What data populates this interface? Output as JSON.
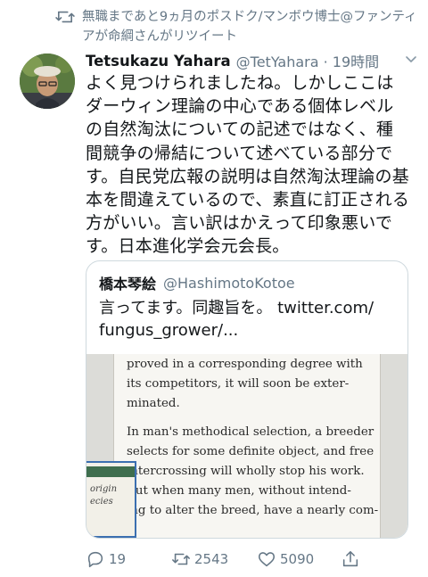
{
  "retweet": {
    "text": "無職まであと9ヵ月のポスドク/マンボウ博士@ファンティアが命綱さんがリツイート",
    "icon": "retweet-icon"
  },
  "tweet": {
    "display_name": "Tetsukazu Yahara",
    "handle_time": "@TetYahara · 19時間",
    "lines": [
      "よく見つけられましたね。しかしここは",
      "ダーウィン理論の中心である個体レベル",
      "の自然淘汰についての記述ではなく、種",
      "間競争の帰結について述べている部分で",
      "す。自民党広報の説明は自然淘汰理論の基",
      "本を間違えているので、素直に訂正される",
      "方がいい。言い訳はかえって印象悪いで",
      "す。日本進化学会元会長。"
    ]
  },
  "quote": {
    "name": "橋本琴絵",
    "handle": "@HashimotoKotoe",
    "line1": "言ってます。同趣旨を。 twitter.com/",
    "line2": "fungus_grower/...",
    "page_lines": [
      "proved in a corresponding degree with",
      "its competitors, it will soon be exter-",
      "minated.",
      "In man's methodical selection, a breeder",
      "selects for some definite object, and free",
      "intercrossing will wholly stop his work.",
      "But when many men, without intend-",
      "ing to alter the breed, have a nearly com-"
    ],
    "thumb_lines": [
      "origin",
      "ecies"
    ]
  },
  "actions": {
    "reply_count": "19",
    "retweet_count": "2543",
    "like_count": "5090"
  },
  "colors": {
    "secondary_text": "#657786",
    "primary_text": "#14171a",
    "border": "#cfd9de"
  }
}
